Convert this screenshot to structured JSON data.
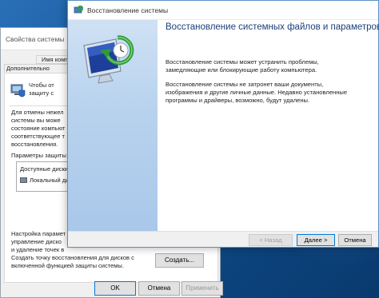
{
  "sysprops": {
    "title": "Свойства системы",
    "tabs": [
      "Имя компь",
      "Дополнительно"
    ],
    "protect_text": "Чтобы от\nзащиту с",
    "restore_text": "Для отмены нежел\nсистемы вы може\nсостояние компьют\nсоответствующее т\nвосстановления.",
    "params_label": "Параметры защиты",
    "list_header": "Доступные диски",
    "list_row": "Локальный ди",
    "config_text": "Настройка парамет\nуправление диско\nи удаление точек в",
    "create_text": "Создать точку восстановления для дисков с\nвключенной функцией защиты системы.",
    "create_button": "Создать...",
    "ok_button": "OK",
    "cancel_button": "Отмена",
    "apply_button": "Применить"
  },
  "restore": {
    "title": "Восстановление системы",
    "heading": "Восстановление системных файлов и параметров",
    "para1": "Восстановление системы может устранить проблемы,\nзамедляющие или блокирующие работу компьютера.",
    "para2": "Восстановление системы не затронет ваши документы,\nизображения и другие личные данные. Недавно установленные\nпрограммы и драйверы, возможно, будут удалены.",
    "back_button": "< Назад",
    "next_button": "Далее >",
    "cancel_button": "Отмена"
  },
  "icons": {
    "title_icon": "system-restore-icon",
    "sidebar_icon": "monitor-restore-icon",
    "shield_icon": "shield-icon",
    "drive_icon": "drive-icon"
  },
  "colors": {
    "accent": "#0078d7",
    "heading": "#1c3f7a",
    "sidebar": "#b9d3ee",
    "desktop": "#0f4d8c"
  }
}
